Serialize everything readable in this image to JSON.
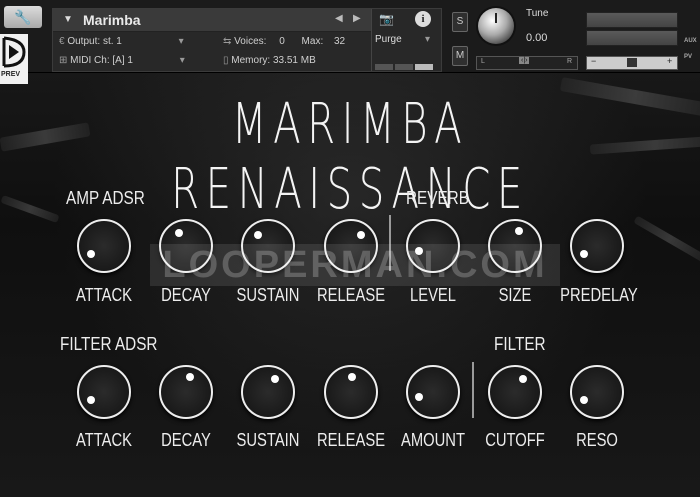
{
  "header": {
    "instrument_name": "Marimba",
    "output_label": "Output:",
    "output_value": "st. 1",
    "voices_label": "Voices:",
    "voices_value": "0",
    "max_label": "Max:",
    "max_value": "32",
    "purge_label": "Purge",
    "midi_label": "MIDI Ch:",
    "midi_value": "[A]  1",
    "memory_label": "Memory:",
    "memory_value": "33.51 MB",
    "s_button": "S",
    "m_button": "M",
    "tune_label": "Tune",
    "tune_value": "0.00",
    "pan_left": "L",
    "pan_center": "‹|›",
    "pan_right": "R",
    "aux_label": "AUX",
    "pv_label": "PV",
    "prev_label": "PREV",
    "vol_minus": "−",
    "vol_plus": "+"
  },
  "title": "MARIMBA RENAISSANCE",
  "sections": {
    "amp": "AMP ADSR",
    "reverb": "REVERB",
    "filter_adsr": "FILTER ADSR",
    "filter": "FILTER"
  },
  "row1_knobs": [
    {
      "label": "ATTACK",
      "level": 0.05
    },
    {
      "label": "DECAY",
      "level": 0.4
    },
    {
      "label": "SUSTAIN",
      "level": 0.35
    },
    {
      "label": "RELEASE",
      "level": 0.65
    },
    {
      "label": "LEVEL",
      "level": 0.1
    },
    {
      "label": "SIZE",
      "level": 0.55
    },
    {
      "label": "PREDELAY",
      "level": 0.05
    }
  ],
  "row2_knobs": [
    {
      "label": "ATTACK",
      "level": 0.05
    },
    {
      "label": "DECAY",
      "level": 0.55
    },
    {
      "label": "SUSTAIN",
      "level": 0.6
    },
    {
      "label": "RELEASE",
      "level": 0.52
    },
    {
      "label": "AMOUNT",
      "level": 0.1
    },
    {
      "label": "CUTOFF",
      "level": 0.62
    },
    {
      "label": "RESO",
      "level": 0.05
    }
  ],
  "watermark": "LOOPERMAN.COM"
}
